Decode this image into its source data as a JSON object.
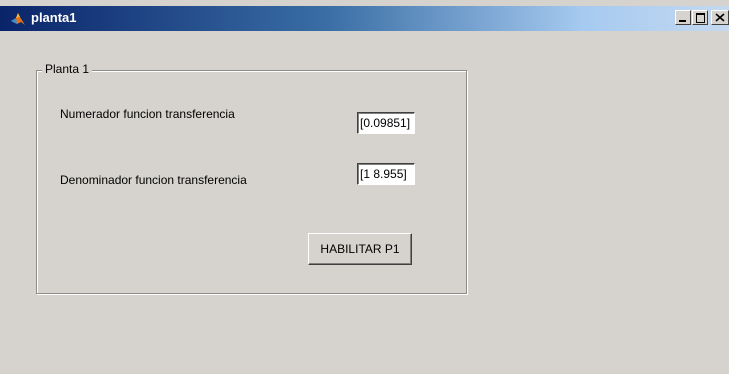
{
  "window": {
    "title": "planta1",
    "controls": [
      "minimize-icon",
      "maximize-icon",
      "close-icon"
    ],
    "title_gradient": [
      "#0a246a",
      "#3a6ea5",
      "#a6caf0"
    ],
    "background": "#d6d3ce"
  },
  "panel": {
    "title": "Planta 1",
    "numerator_label": "Numerador funcion transferencia",
    "numerator_value": "[0.09851]",
    "denominator_label": "Denominador funcion transferencia",
    "denominator_value": "[1 8.955]",
    "enable_button_label": "HABILITAR P1"
  }
}
